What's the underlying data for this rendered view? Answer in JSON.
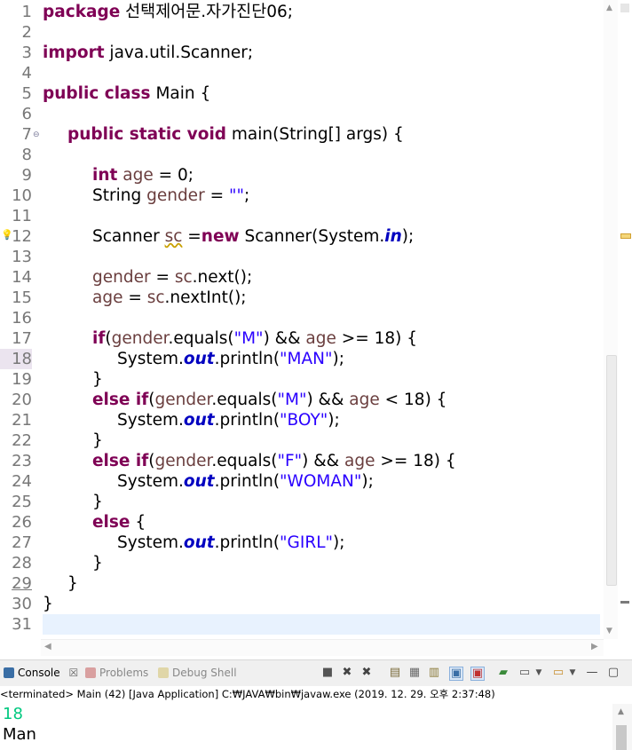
{
  "editor": {
    "line_numbers": [
      "1",
      "2",
      "3",
      "4",
      "5",
      "6",
      "7",
      "8",
      "9",
      "10",
      "11",
      "12",
      "13",
      "14",
      "15",
      "16",
      "17",
      "18",
      "19",
      "20",
      "21",
      "22",
      "23",
      "24",
      "25",
      "26",
      "27",
      "28",
      "29",
      "30",
      "31"
    ],
    "lines": {
      "l1_kw": "package",
      "l1_rest": " 선택제어문.자가진단06;",
      "l3_kw": "import",
      "l3_rest": " java.util.Scanner;",
      "l5_kw": "public class",
      "l5_rest": " Main {",
      "l7_kw": "public static void",
      "l7_rest": " main(String[] args) {",
      "l9_kw": "int",
      "l9_var": "age",
      "l9_rest": " = 0;",
      "l10_a": "String ",
      "l10_var": "gender",
      "l10_rest": " = ",
      "l10_str": "\"\"",
      "l10_end": ";",
      "l12_a": "Scanner ",
      "l12_var": "sc",
      "l12_b": " =",
      "l12_kw": "new",
      "l12_c": " Scanner(System.",
      "l12_fld": "in",
      "l12_end": ");",
      "l14_var": "gender",
      "l14_b": " = ",
      "l14_var2": "sc",
      "l14_rest": ".next();",
      "l15_var": "age",
      "l15_b": " = ",
      "l15_var2": "sc",
      "l15_rest": ".nextInt();",
      "l17_kw": "if",
      "l17_a": "(",
      "l17_var": "gender",
      "l17_b": ".equals(",
      "l17_str": "\"M\"",
      "l17_c": ") && ",
      "l17_var2": "age",
      "l17_rest": " >= 18) {",
      "l18_a": "System.",
      "l18_fld": "out",
      "l18_b": ".println(",
      "l18_str": "\"MAN\"",
      "l18_end": ");",
      "l19": "}",
      "l20_kw": "else if",
      "l20_a": "(",
      "l20_var": "gender",
      "l20_b": ".equals(",
      "l20_str": "\"M\"",
      "l20_c": ") && ",
      "l20_var2": "age",
      "l20_rest": " < 18) {",
      "l21_a": "System.",
      "l21_fld": "out",
      "l21_b": ".println(",
      "l21_str": "\"BOY\"",
      "l21_end": ");",
      "l22": "}",
      "l23_kw": "else if",
      "l23_a": "(",
      "l23_var": "gender",
      "l23_b": ".equals(",
      "l23_str": "\"F\"",
      "l23_c": ") && ",
      "l23_var2": "age",
      "l23_rest": " >= 18) {",
      "l24_a": "System.",
      "l24_fld": "out",
      "l24_b": ".println(",
      "l24_str": "\"WOMAN\"",
      "l24_end": ");",
      "l25": "}",
      "l26_kw": "else",
      "l26_rest": " {",
      "l27_a": "System.",
      "l27_fld": "out",
      "l27_b": ".println(",
      "l27_str": "\"GIRL\"",
      "l27_end": ");",
      "l28": "}",
      "l29": "}",
      "l30": "}"
    }
  },
  "console": {
    "tabs": [
      {
        "label": "Console",
        "icon": "console-icon",
        "active": true
      },
      {
        "label": "Problems",
        "icon": "problems-icon",
        "active": false
      },
      {
        "label": "Debug Shell",
        "icon": "debug-shell-icon",
        "active": false
      }
    ],
    "close_glyph": "☒",
    "status": "<terminated> Main (42) [Java Application] C:₩JAVA₩bin₩javaw.exe (2019. 12. 29. 오후 2:37:48)",
    "output": [
      "18",
      "Man"
    ],
    "input_color": "#00c87f"
  },
  "colors": {
    "keyword": "#7f0055",
    "string": "#2a00ff",
    "local_variable": "#6a3e3e",
    "static_field": "#0000c0",
    "current_line": "#e8f2fe"
  }
}
